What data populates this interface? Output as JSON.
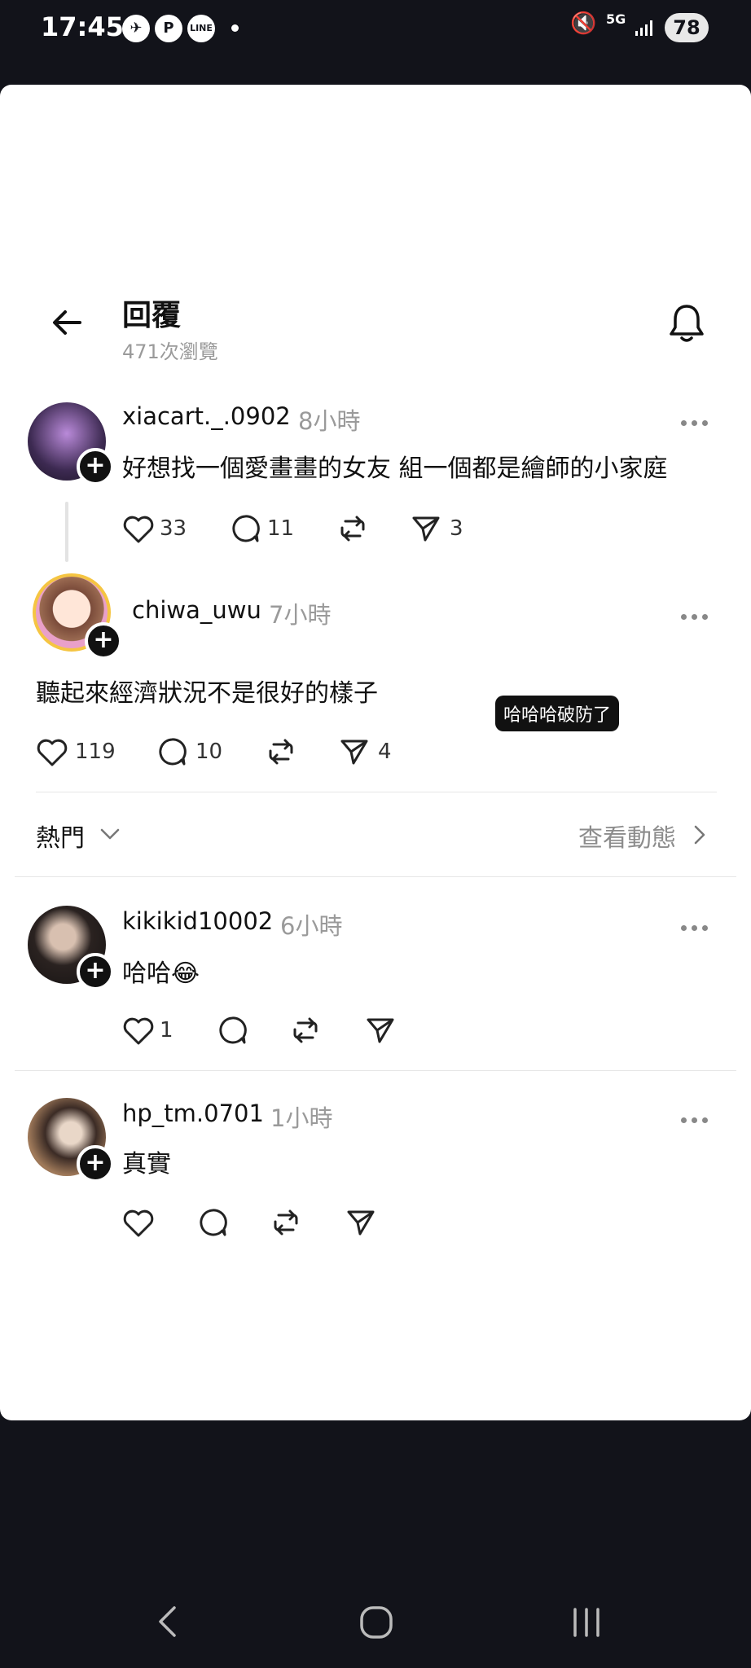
{
  "status_bar": {
    "time": "17:45",
    "line_label": "LINE",
    "p_label": "P",
    "network": "5G",
    "battery": "78"
  },
  "header": {
    "title": "回覆",
    "views": "471次瀏覽"
  },
  "posts": [
    {
      "username": "xiacart._.0902",
      "time": "8小時",
      "text": "好想找一個愛畫畫的女友 組一個都是繪師的小家庭",
      "likes": "33",
      "comments": "11",
      "shares": "3"
    },
    {
      "username": "chiwa_uwu",
      "time": "7小時",
      "text": "聽起來經濟狀況不是很好的樣子",
      "likes": "119",
      "comments": "10",
      "shares": "4",
      "tooltip": "哈哈哈破防了"
    }
  ],
  "sort": {
    "label": "熱門",
    "view_activity": "查看動態"
  },
  "replies": [
    {
      "username": "kikikid10002",
      "time": "6小時",
      "text": "哈哈😂",
      "likes": "1"
    },
    {
      "username": "hp_tm.0701",
      "time": "1小時",
      "text": "真實"
    }
  ]
}
